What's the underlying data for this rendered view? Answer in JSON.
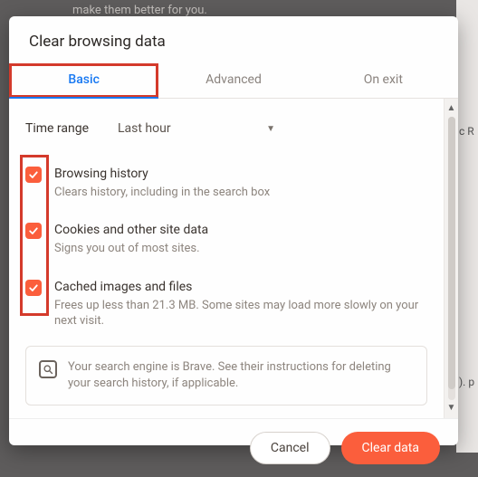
{
  "background": {
    "snippet": "make them better for you.",
    "side_text1": "c R",
    "side_text2": "). p"
  },
  "dialog": {
    "title": "Clear browsing data",
    "tabs": {
      "basic": "Basic",
      "advanced": "Advanced",
      "onexit": "On exit"
    },
    "time_range": {
      "label": "Time range",
      "value": "Last hour"
    },
    "options": [
      {
        "title": "Browsing history",
        "desc": "Clears history, including in the search box"
      },
      {
        "title": "Cookies and other site data",
        "desc": "Signs you out of most sites."
      },
      {
        "title": "Cached images and files",
        "desc": "Frees up less than 21.3 MB. Some sites may load more slowly on your next visit."
      }
    ],
    "notice": "Your search engine is Brave. See their instructions for deleting your search history, if applicable.",
    "buttons": {
      "cancel": "Cancel",
      "clear": "Clear data"
    }
  },
  "colors": {
    "accent": "#fb5e3c",
    "tab_active": "#1778f2",
    "highlight": "#d43a2b"
  }
}
